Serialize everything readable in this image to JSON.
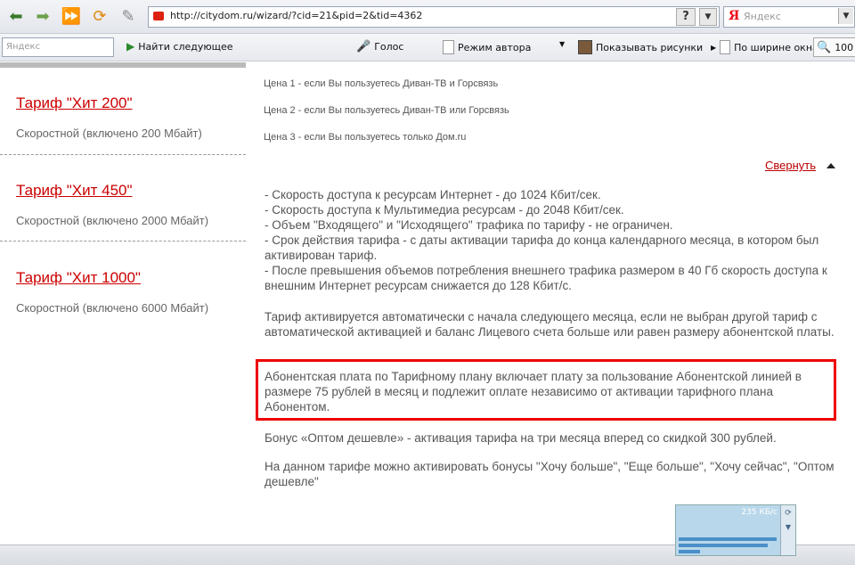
{
  "browser": {
    "url": "http://citydom.ru/wizard/?cid=21&pid=2&tid=4362",
    "help_label": "?",
    "search_logo": "Я",
    "search_placeholder": "Яндекс"
  },
  "toolbar": {
    "yandex_placeholder": "Яндекс",
    "find_next": "Найти следующее",
    "voice": "Голос",
    "author_mode": "Режим автора",
    "show_images": "Показывать рисунки",
    "fit_width": "По ширине окна",
    "zoom": "100"
  },
  "sidebar": {
    "tariffs": [
      {
        "name": "Тариф \"Хит 200\"",
        "desc": "Скоростной (включено 200 Мбайт)"
      },
      {
        "name": "Тариф \"Хит 450\"",
        "desc": "Скоростной (включено 2000 Мбайт)"
      },
      {
        "name": "Тариф \"Хит 1000\"",
        "desc": "Скоростной (включено 6000 Мбайт)"
      }
    ]
  },
  "main": {
    "prices": [
      "Цена 1 - если Вы пользуетесь Диван-ТВ и Горсвязь",
      "Цена 2 - если Вы пользуетесь Диван-ТВ или Горсвязь",
      "Цена 3 - если Вы пользуетесь только Дом.ru"
    ],
    "collapse_label": "Свернуть",
    "features": [
      "- Скорость доступа к ресурсам Интернет - до 1024 Кбит/сек.",
      "- Скорость доступа к Мультимедиа ресурсам - до 2048 Кбит/сек.",
      "- Объем \"Входящего\" и \"Исходящего\" трафика по тарифу - не ограничен.",
      "- Срок действия тарифа - с даты активации тарифа до конца календарного месяца, в котором был активирован тариф.",
      "- После превышения объемов потребления внешнего трафика размером в 40 Гб скорость доступа к внешним Интернет ресурсам снижается до 128 Кбит/с."
    ],
    "activation_text": "Тариф активируется автоматически с начала следующего месяца, если не выбран другой тариф с автоматической активацией и баланс Лицевого счета больше или равен размеру абонентской платы.",
    "fee_text": "Абонентская плата по Тарифному плану включает плату за пользование Абонентской линией в размере 75 рублей в месяц и подлежит оплате независимо от активации тарифного плана Абонентом.",
    "bonus_text": "Бонус «Оптом дешевле» - активация тарифа на три месяца вперед со скидкой 300 рублей.",
    "bonuses_text": "На данном тарифе можно активировать бонусы \"Хочу больше\", \"Еще больше\", \"Хочу сейчас\", \"Оптом дешевле\""
  },
  "widget": {
    "rate": "235 КБ/с"
  },
  "colors": {
    "link_red": "#cc0000",
    "highlight_box": "#ee0000"
  }
}
